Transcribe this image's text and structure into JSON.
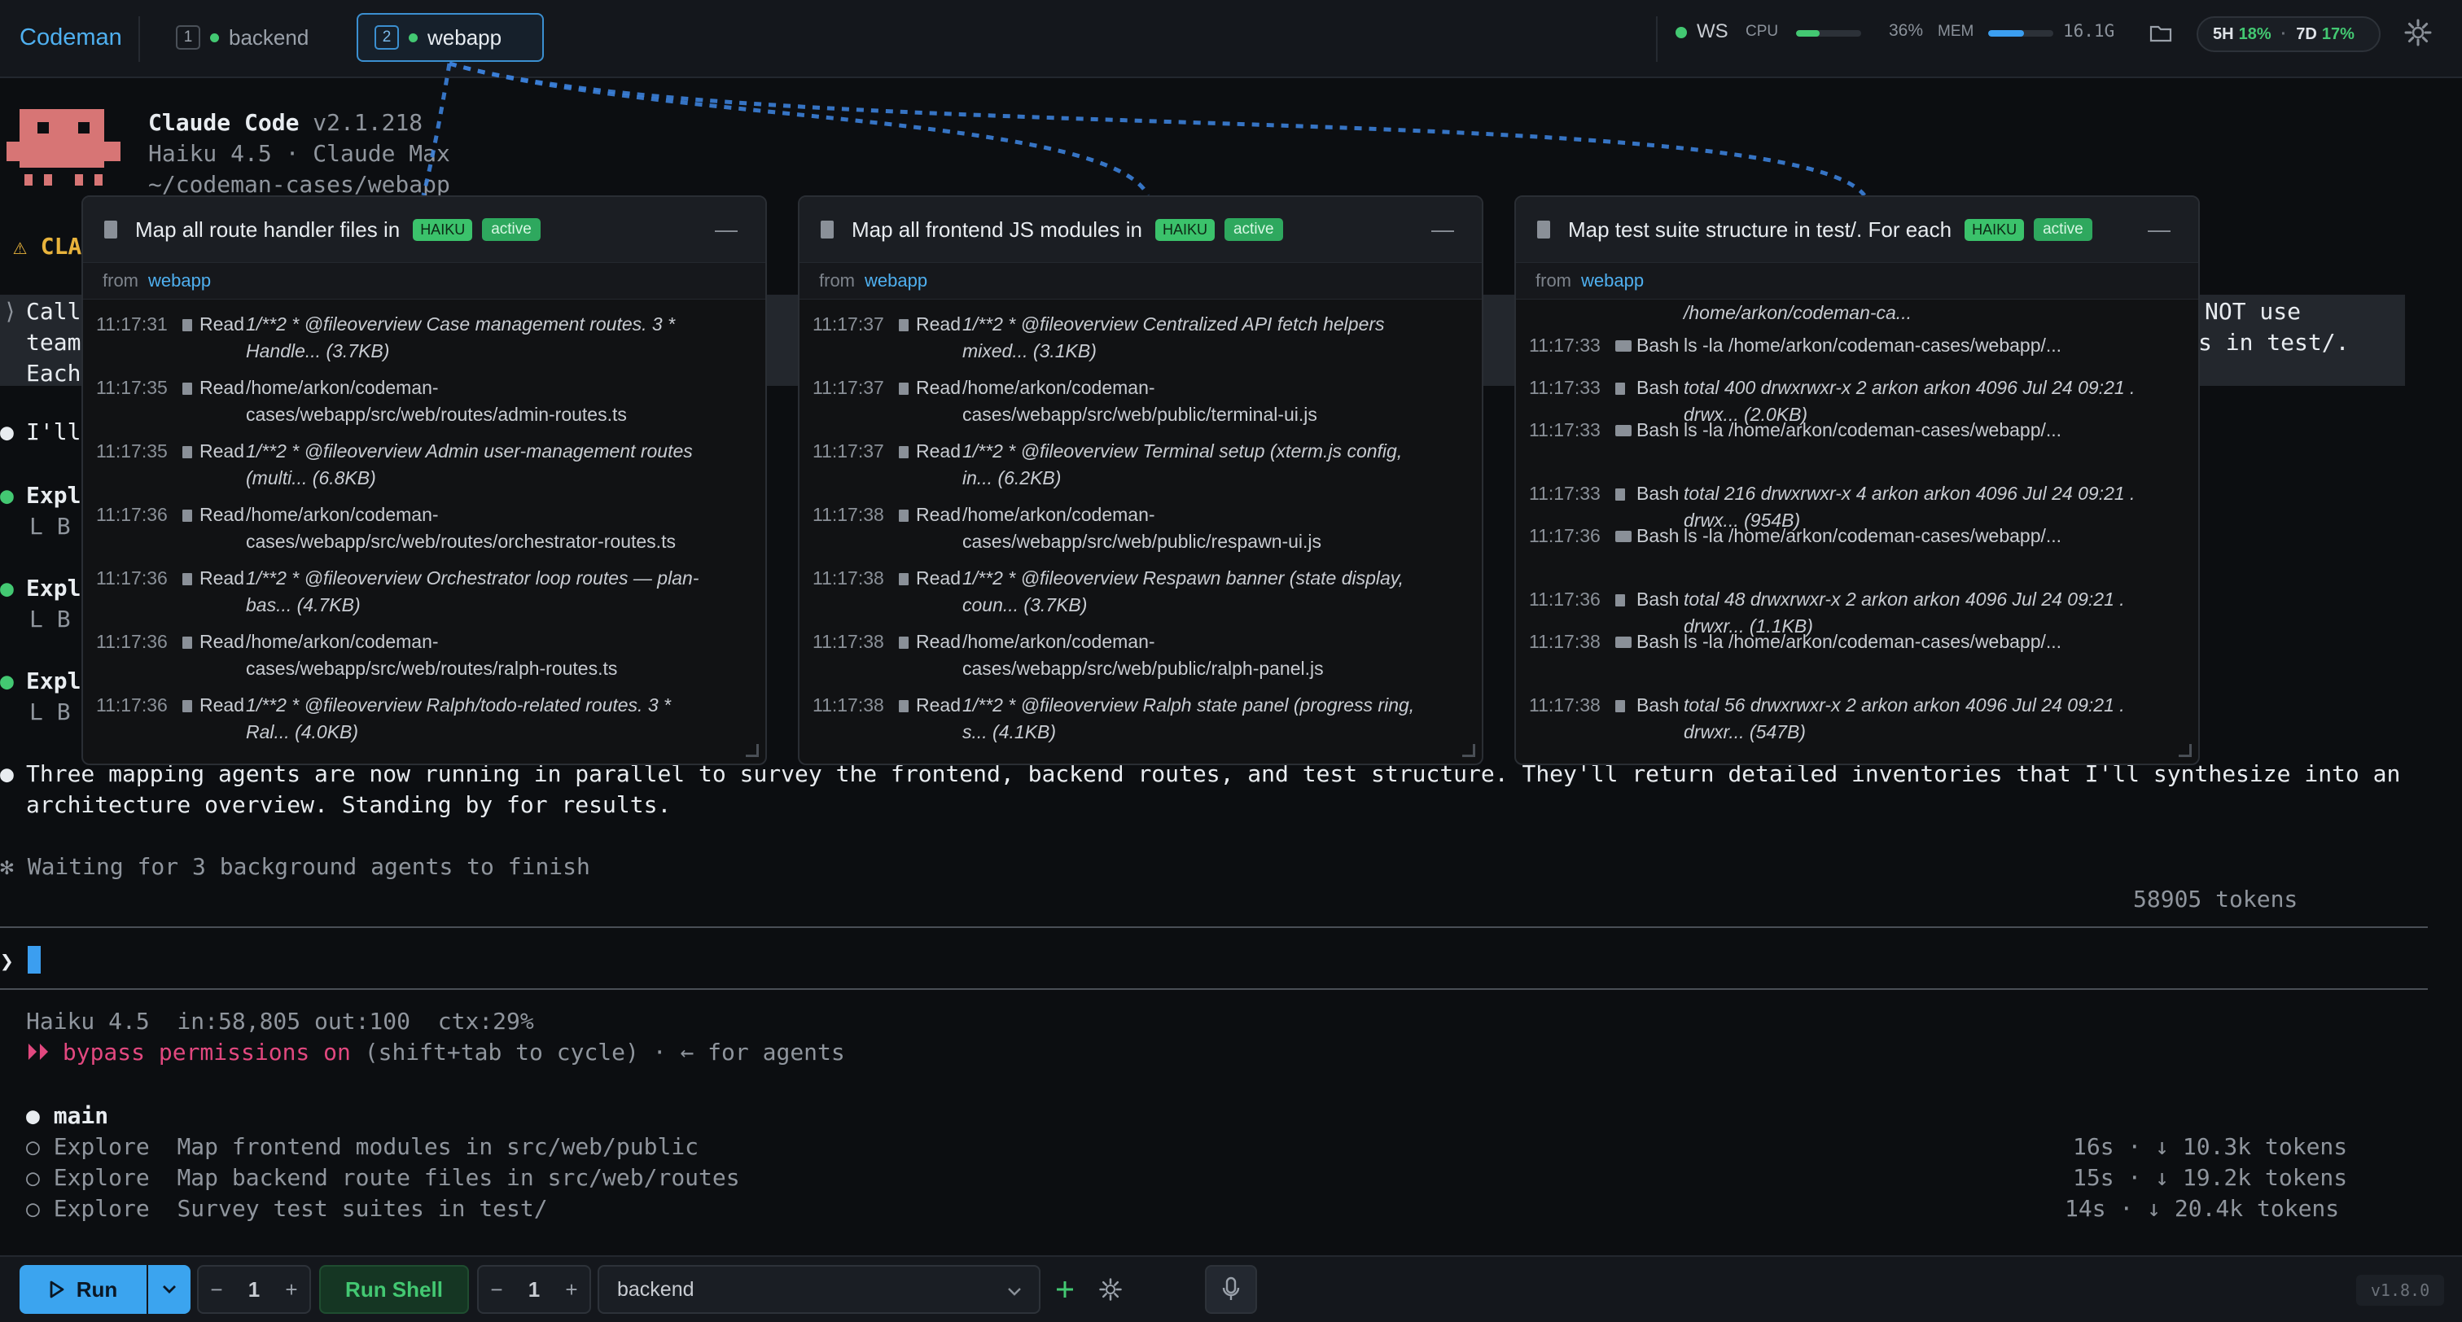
{
  "header": {
    "brand": "Codeman",
    "tabs": [
      {
        "num": "1",
        "label": "backend"
      },
      {
        "num": "2",
        "label": "webapp"
      }
    ],
    "ws_label": "WS",
    "cpu_label": "CPU",
    "cpu_value": "36%",
    "cpu_fraction": 0.36,
    "mem_label": "MEM",
    "mem_value": "16.1G",
    "mem_fraction": 0.55,
    "usage": {
      "five_h_label": "5H",
      "five_h_value": "18%",
      "seven_d_label": "7D",
      "seven_d_value": "17%"
    },
    "colors": {
      "accent": "#3b9ef0",
      "ok": "#43c872",
      "danger": "#e2487f"
    },
    "icons": [
      "folder-icon",
      "gear-icon"
    ]
  },
  "terminal": {
    "app_name": "Claude Code",
    "app_version": "v2.1.218",
    "model_line": "Haiku 4.5 · Claude Max",
    "cwd": "~/codeman-cases/webapp",
    "warn_prefix": "⚠ CLA",
    "quoted_left": [
      "Call",
      "team",
      "Each"
    ],
    "quoted_right": [
      "NOT use",
      "s in test/."
    ],
    "partial_ill": "I'll",
    "explore_rows": [
      {
        "title": "Expl",
        "sub": "B"
      },
      {
        "title": "Expl",
        "sub": "B"
      },
      {
        "title": "Expl",
        "sub": "B"
      }
    ],
    "summary_1": "Three mapping agents are now running in parallel to survey the frontend, backend routes, and test structure. They'll return detailed inventories that I'll synthesize into an",
    "summary_2": "architecture overview. Standing by for results.",
    "waiting": "✻ Waiting for 3 background agents to finish",
    "tokens": "58905 tokens",
    "prompt_char": "❯",
    "status_model": "Haiku 4.5  in:58,805 out:100  ctx:29%",
    "bypass_flag": "⏵⏵ bypass permissions on",
    "bypass_rest": " (shift+tab to cycle) · ← for agents",
    "main_label": "main",
    "agents": [
      {
        "kind": "Explore",
        "desc": "Map frontend modules in src/web/public",
        "stats": "16s · ↓ 10.3k tokens"
      },
      {
        "kind": "Explore",
        "desc": "Map backend route files in src/web/routes",
        "stats": "15s · ↓ 19.2k tokens"
      },
      {
        "kind": "Explore",
        "desc": "Survey test suites in test/",
        "stats": "14s · ↓ 20.4k tokens"
      }
    ]
  },
  "panels": [
    {
      "title": "Map all route handler files in",
      "model_badge": "HAIKU",
      "state_badge": "active",
      "from_label": "from",
      "from_value": "webapp",
      "rows": [
        {
          "time": "11:17:31",
          "tool": "Read",
          "italic": true,
          "lines": [
            "1/**2 * @fileoverview Case management routes. 3 *",
            "Handle... (3.7KB)"
          ]
        },
        {
          "time": "11:17:35",
          "tool": "Read",
          "italic": false,
          "lines": [
            "/home/arkon/codeman-",
            "cases/webapp/src/web/routes/admin-routes.ts"
          ]
        },
        {
          "time": "11:17:35",
          "tool": "Read",
          "italic": true,
          "lines": [
            "1/**2 * @fileoverview Admin user-management routes",
            "(multi... (6.8KB)"
          ]
        },
        {
          "time": "11:17:36",
          "tool": "Read",
          "italic": false,
          "lines": [
            "/home/arkon/codeman-",
            "cases/webapp/src/web/routes/orchestrator-routes.ts"
          ]
        },
        {
          "time": "11:17:36",
          "tool": "Read",
          "italic": true,
          "lines": [
            "1/**2 * @fileoverview Orchestrator loop routes — plan-",
            "bas... (4.7KB)"
          ]
        },
        {
          "time": "11:17:36",
          "tool": "Read",
          "italic": false,
          "lines": [
            "/home/arkon/codeman-",
            "cases/webapp/src/web/routes/ralph-routes.ts"
          ]
        },
        {
          "time": "11:17:36",
          "tool": "Read",
          "italic": true,
          "lines": [
            "1/**2 * @fileoverview Ralph/todo-related routes. 3 *",
            "Ral... (4.0KB)"
          ]
        }
      ]
    },
    {
      "title": "Map all frontend JS modules in",
      "model_badge": "HAIKU",
      "state_badge": "active",
      "from_label": "from",
      "from_value": "webapp",
      "rows": [
        {
          "time": "11:17:37",
          "tool": "Read",
          "italic": true,
          "lines": [
            "1/**2 * @fileoverview Centralized API fetch helpers",
            "mixed... (3.1KB)"
          ]
        },
        {
          "time": "11:17:37",
          "tool": "Read",
          "italic": false,
          "lines": [
            "/home/arkon/codeman-",
            "cases/webapp/src/web/public/terminal-ui.js"
          ]
        },
        {
          "time": "11:17:37",
          "tool": "Read",
          "italic": true,
          "lines": [
            "1/**2 * @fileoverview Terminal setup (xterm.js config,",
            "in... (6.2KB)"
          ]
        },
        {
          "time": "11:17:38",
          "tool": "Read",
          "italic": false,
          "lines": [
            "/home/arkon/codeman-",
            "cases/webapp/src/web/public/respawn-ui.js"
          ]
        },
        {
          "time": "11:17:38",
          "tool": "Read",
          "italic": true,
          "lines": [
            "1/**2 * @fileoverview Respawn banner (state display,",
            "coun... (3.7KB)"
          ]
        },
        {
          "time": "11:17:38",
          "tool": "Read",
          "italic": false,
          "lines": [
            "/home/arkon/codeman-",
            "cases/webapp/src/web/public/ralph-panel.js"
          ]
        },
        {
          "time": "11:17:38",
          "tool": "Read",
          "italic": true,
          "lines": [
            "1/**2 * @fileoverview Ralph state panel (progress ring,",
            "s... (4.1KB)"
          ]
        }
      ]
    },
    {
      "title": "Map test suite structure in test/. For each",
      "model_badge": "HAIKU",
      "state_badge": "active",
      "from_label": "from",
      "from_value": "webapp",
      "top_fragment": "/home/arkon/codeman-ca...",
      "rows": [
        {
          "time": "11:17:33",
          "tool": "Bash",
          "italic": false,
          "term": true,
          "lines": [
            "ls -la /home/arkon/codeman-cases/webapp/..."
          ]
        },
        {
          "time": "11:17:33",
          "tool": "Bash",
          "italic": true,
          "lines": [
            "total 400 drwxrwxr-x 2 arkon arkon 4096 Jul 24 09:21 .",
            "drwx... (2.0KB)"
          ]
        },
        {
          "time": "11:17:33",
          "tool": "Bash",
          "italic": false,
          "term": true,
          "lines": [
            "ls -la /home/arkon/codeman-cases/webapp/..."
          ]
        },
        {
          "time": "11:17:33",
          "tool": "Bash",
          "italic": true,
          "lines": [
            "total 216 drwxrwxr-x 4 arkon arkon 4096 Jul 24 09:21 .",
            "drwx... (954B)"
          ]
        },
        {
          "time": "11:17:36",
          "tool": "Bash",
          "italic": false,
          "term": true,
          "lines": [
            "ls -la /home/arkon/codeman-cases/webapp/..."
          ]
        },
        {
          "time": "11:17:36",
          "tool": "Bash",
          "italic": true,
          "lines": [
            "total 48 drwxrwxr-x 2 arkon arkon 4096 Jul 24 09:21 .",
            "drwxr... (1.1KB)"
          ]
        },
        {
          "time": "11:17:38",
          "tool": "Bash",
          "italic": false,
          "term": true,
          "lines": [
            "ls -la /home/arkon/codeman-cases/webapp/..."
          ]
        },
        {
          "time": "11:17:38",
          "tool": "Bash",
          "italic": true,
          "lines": [
            "total 56 drwxrwxr-x 2 arkon arkon 4096 Jul 24 09:21 .",
            "drwxr... (547B)"
          ]
        }
      ]
    }
  ],
  "footer": {
    "run_label": "Run",
    "run_count": "1",
    "shell_label": "Run Shell",
    "shell_count": "1",
    "case_value": "backend",
    "minus": "−",
    "plus": "+",
    "version": "v1.8.0",
    "icons": [
      "play-icon",
      "chevron-down-icon",
      "plus-icon",
      "gear-icon",
      "microphone-icon"
    ]
  }
}
